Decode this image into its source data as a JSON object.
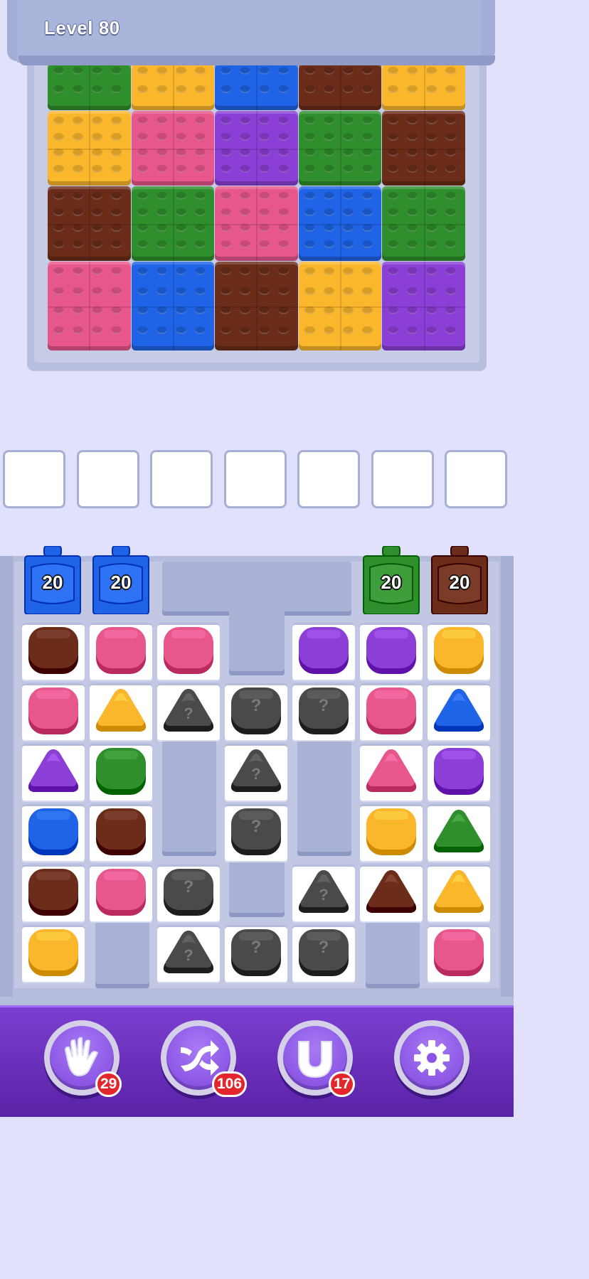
{
  "header": {
    "level_label": "Level 80"
  },
  "colors": {
    "green": "#2f8f2c",
    "yellow": "#fbb72c",
    "blue": "#1f63e6",
    "brown": "#6b2d1a",
    "pink": "#e8578c",
    "purple": "#8c3fd6",
    "gray": "#4a4a4a"
  },
  "brick_rows": [
    [
      "green",
      "yellow",
      "blue",
      "brown",
      "yellow"
    ],
    [
      "yellow",
      "pink",
      "purple",
      "green",
      "brown"
    ],
    [
      "brown",
      "green",
      "pink",
      "blue",
      "green"
    ],
    [
      "pink",
      "blue",
      "brown",
      "yellow",
      "purple"
    ]
  ],
  "slots": {
    "count": 7
  },
  "bottles": [
    {
      "color": "blue",
      "count": "20"
    },
    {
      "color": "blue",
      "count": "20"
    },
    {
      "color": "green",
      "count": "20"
    },
    {
      "color": "brown",
      "count": "20"
    }
  ],
  "pieces": [
    {
      "row": 0,
      "col": 0,
      "shape": "square",
      "color": "brown"
    },
    {
      "row": 0,
      "col": 1,
      "shape": "square",
      "color": "pink"
    },
    {
      "row": 0,
      "col": 2,
      "shape": "square",
      "color": "pink"
    },
    {
      "row": 0,
      "col": 4,
      "shape": "square",
      "color": "purple"
    },
    {
      "row": 0,
      "col": 5,
      "shape": "square",
      "color": "purple"
    },
    {
      "row": 0,
      "col": 6,
      "shape": "square",
      "color": "yellow"
    },
    {
      "row": 1,
      "col": 0,
      "shape": "square",
      "color": "pink"
    },
    {
      "row": 1,
      "col": 1,
      "shape": "triangle",
      "color": "yellow"
    },
    {
      "row": 1,
      "col": 2,
      "shape": "triangle",
      "color": "gray",
      "hidden": "?"
    },
    {
      "row": 1,
      "col": 3,
      "shape": "square",
      "color": "gray",
      "hidden": "?"
    },
    {
      "row": 1,
      "col": 4,
      "shape": "square",
      "color": "gray",
      "hidden": "?"
    },
    {
      "row": 1,
      "col": 5,
      "shape": "square",
      "color": "pink"
    },
    {
      "row": 1,
      "col": 6,
      "shape": "triangle",
      "color": "blue"
    },
    {
      "row": 2,
      "col": 0,
      "shape": "triangle",
      "color": "purple"
    },
    {
      "row": 2,
      "col": 1,
      "shape": "square",
      "color": "green"
    },
    {
      "row": 2,
      "col": 3,
      "shape": "triangle",
      "color": "gray",
      "hidden": "?"
    },
    {
      "row": 2,
      "col": 5,
      "shape": "triangle",
      "color": "pink"
    },
    {
      "row": 2,
      "col": 6,
      "shape": "square",
      "color": "purple"
    },
    {
      "row": 3,
      "col": 0,
      "shape": "square",
      "color": "blue"
    },
    {
      "row": 3,
      "col": 1,
      "shape": "square",
      "color": "brown"
    },
    {
      "row": 3,
      "col": 3,
      "shape": "square",
      "color": "gray",
      "hidden": "?"
    },
    {
      "row": 3,
      "col": 5,
      "shape": "square",
      "color": "yellow"
    },
    {
      "row": 3,
      "col": 6,
      "shape": "triangle",
      "color": "green"
    },
    {
      "row": 4,
      "col": 0,
      "shape": "square",
      "color": "brown"
    },
    {
      "row": 4,
      "col": 1,
      "shape": "square",
      "color": "pink"
    },
    {
      "row": 4,
      "col": 2,
      "shape": "square",
      "color": "gray",
      "hidden": "?"
    },
    {
      "row": 4,
      "col": 4,
      "shape": "triangle",
      "color": "gray",
      "hidden": "?"
    },
    {
      "row": 4,
      "col": 5,
      "shape": "triangle",
      "color": "brown"
    },
    {
      "row": 4,
      "col": 6,
      "shape": "triangle",
      "color": "yellow"
    },
    {
      "row": 5,
      "col": 0,
      "shape": "square",
      "color": "yellow"
    },
    {
      "row": 5,
      "col": 2,
      "shape": "triangle",
      "color": "gray",
      "hidden": "?"
    },
    {
      "row": 5,
      "col": 3,
      "shape": "square",
      "color": "gray",
      "hidden": "?"
    },
    {
      "row": 5,
      "col": 4,
      "shape": "square",
      "color": "gray",
      "hidden": "?"
    },
    {
      "row": 5,
      "col": 6,
      "shape": "square",
      "color": "pink"
    }
  ],
  "toolbar": {
    "hand": {
      "icon": "hand-icon",
      "badge": "29"
    },
    "shuffle": {
      "icon": "shuffle-icon",
      "badge": "106"
    },
    "magnet": {
      "icon": "magnet-icon",
      "badge": "17"
    },
    "settings": {
      "icon": "gear-icon"
    }
  }
}
